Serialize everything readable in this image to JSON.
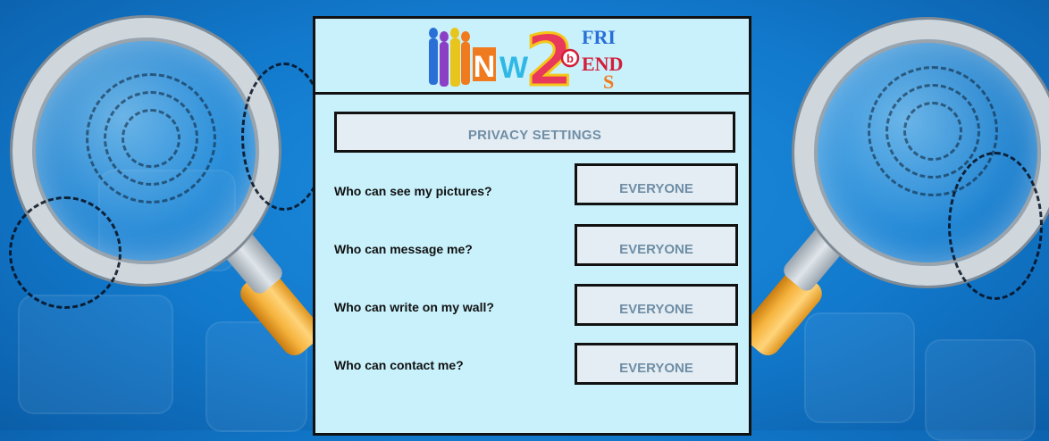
{
  "logo": {
    "text_new": "N",
    "text_w": "W",
    "text_2": "2",
    "text_be": "b",
    "text_friends_1": "FRI",
    "text_friends_2": "END",
    "text_friends_3": "S"
  },
  "privacy": {
    "title": "PRIVACY SETTINGS",
    "rows": [
      {
        "question": "Who can see my pictures?",
        "value": "EVERYONE"
      },
      {
        "question": "Who can message me?",
        "value": "EVERYONE"
      },
      {
        "question": "Who can write on my wall?",
        "value": "EVERYONE"
      },
      {
        "question": "Who can contact me?",
        "value": "EVERYONE"
      }
    ]
  },
  "colors": {
    "panel_bg": "#c8f1fb",
    "button_bg": "#e4edf3",
    "button_text": "#6f8ea6",
    "background_blue": "#1279cc",
    "handle_orange": "#f6b43e"
  }
}
